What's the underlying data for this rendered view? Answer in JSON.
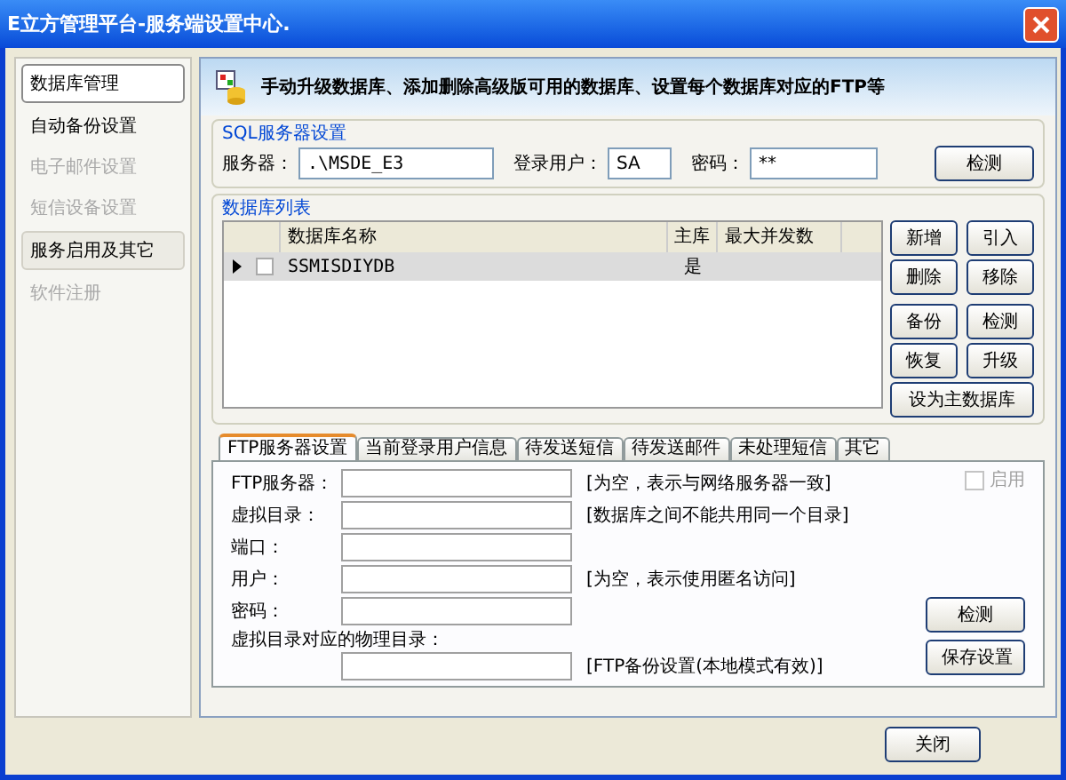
{
  "window": {
    "title": "E立方管理平台-服务端设置中心."
  },
  "sidebar": {
    "items": [
      {
        "label": "数据库管理",
        "kind": "header",
        "selected": true,
        "disabled": false
      },
      {
        "label": "自动备份设置",
        "kind": "item",
        "selected": false,
        "disabled": false
      },
      {
        "label": "电子邮件设置",
        "kind": "item",
        "selected": false,
        "disabled": true
      },
      {
        "label": "短信设备设置",
        "kind": "item",
        "selected": false,
        "disabled": true
      },
      {
        "label": "服务启用及其它",
        "kind": "header",
        "selected": false,
        "disabled": false
      },
      {
        "label": "软件注册",
        "kind": "item",
        "selected": false,
        "disabled": true
      }
    ]
  },
  "header": {
    "text": "手动升级数据库、添加删除高级版可用的数据库、设置每个数据库对应的FTP等"
  },
  "sql_server": {
    "title": "SQL服务器设置",
    "server_label": "服务器：",
    "server": ".\\MSDE_E3",
    "user_label": "登录用户：",
    "user": "SA",
    "password_label": "密码：",
    "password": "**",
    "button": "检测"
  },
  "db_list": {
    "title": "数据库列表",
    "columns": [
      "数据库名称",
      "主库",
      "最大并发数"
    ],
    "rows": [
      {
        "selected": true,
        "checked": false,
        "cells": [
          "SSMISDIYDB",
          "是"
        ]
      }
    ],
    "buttons": [
      [
        "新增",
        "引入"
      ],
      [
        "删除",
        "移除"
      ],
      [
        "备份",
        "检测"
      ],
      [
        "恢复",
        "升级"
      ]
    ],
    "main_button": "设为主数据库"
  },
  "tabs": [
    {
      "label": "FTP服务器设置",
      "selected": true
    },
    {
      "label": "当前登录用户信息",
      "selected": false
    },
    {
      "label": "待发送短信",
      "selected": false
    },
    {
      "label": "待发送邮件",
      "selected": false
    },
    {
      "label": "未处理短信",
      "selected": false
    },
    {
      "label": "其它",
      "selected": false
    }
  ],
  "ftp": {
    "fields": [
      {
        "label": "FTP服务器：",
        "hint": "[为空，表示与网络服务器一致]"
      },
      {
        "label": "虚拟目录：",
        "hint": "[数据库之间不能共用同一个目录]"
      },
      {
        "label": "端口："
      },
      {
        "label": "用户：",
        "hint": "[为空，表示使用匿名访问]"
      },
      {
        "label": "密码："
      },
      {
        "label": "虚拟目录对应的物理目录：",
        "hint": "[FTP备份设置(本地模式有效)]",
        "kind": "below"
      }
    ],
    "enable": {
      "label": "启用",
      "checked": false,
      "disabled": true
    },
    "buttons": [
      "检测",
      "保存设置"
    ]
  },
  "footer": {
    "close": "关闭"
  }
}
